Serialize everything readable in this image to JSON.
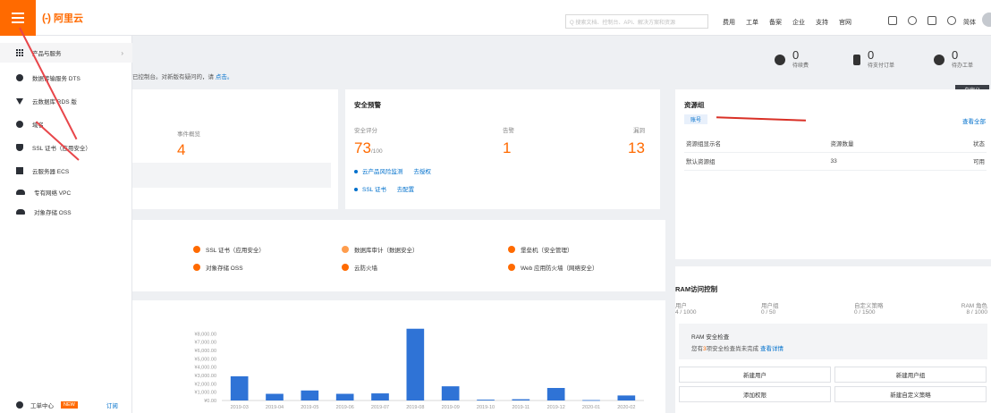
{
  "header": {
    "logo_mark": "(-)",
    "logo_text": "阿里云",
    "search_placeholder": "Q 搜索文档、控制台、API、解决方案和资源",
    "nav": [
      "费用",
      "工单",
      "备案",
      "企业",
      "支持",
      "官网"
    ],
    "lang": "简体"
  },
  "sidebar": {
    "items": [
      {
        "label": "产品与服务",
        "icon": "grid-icon"
      },
      {
        "label": "数据传输服务 DTS",
        "icon": "dts-icon"
      },
      {
        "label": "云数据库 RDS 版",
        "icon": "rds-icon"
      },
      {
        "label": "域名",
        "icon": "globe-icon"
      },
      {
        "label": "SSL 证书（应用安全）",
        "icon": "shield-icon"
      },
      {
        "label": "云服务器 ECS",
        "icon": "server-icon"
      },
      {
        "label": "专有网络 VPC",
        "icon": "cloud-icon"
      },
      {
        "label": "对象存储 OSS",
        "icon": "storage-icon"
      }
    ],
    "bottom": {
      "label": "工单中心",
      "badge": "NEW",
      "link": "订阅"
    }
  },
  "notice": {
    "text": "已控制台。对新版有疑问的，请 ",
    "link": "点击。"
  },
  "counters": [
    {
      "value": "0",
      "label": "待续费"
    },
    {
      "value": "0",
      "label": "待支付订单"
    },
    {
      "value": "0",
      "label": "待办工单"
    }
  ],
  "customize_label": "自定义",
  "overview": {
    "label": "事件概览",
    "value": "4"
  },
  "security": {
    "title": "安全预警",
    "score_label": "安全评分",
    "score": "73",
    "score_total": "/100",
    "alert_label": "告警",
    "alert": "1",
    "vuln_label": "漏洞",
    "vuln": "13",
    "links": [
      {
        "label": "云产品风险监测",
        "action": "去授权"
      },
      {
        "label": "SSL 证书",
        "action": "去配置"
      }
    ]
  },
  "services": [
    {
      "label": "SSL 证书（应用安全）",
      "color": "#ff6a00"
    },
    {
      "label": "数据库审计（数据安全）",
      "color": "#ff9d4d"
    },
    {
      "label": "堡垒机（安全管理）",
      "color": "#ff6a00"
    },
    {
      "label": "对象存储 OSS",
      "color": "#ff6a00"
    },
    {
      "label": "云防火墙",
      "color": "#ff6a00"
    },
    {
      "label": "Web 应用防火墙（网络安全）",
      "color": "#ff6a00"
    }
  ],
  "resource_group": {
    "title": "资源组",
    "view_all": "查看全部",
    "account_tab": "账号",
    "headers": [
      "资源组显示名",
      "资源数量",
      "状态"
    ],
    "rows": [
      [
        "默认资源组",
        "33",
        "可用"
      ]
    ]
  },
  "ram": {
    "title": "RAM访问控制",
    "stats": [
      {
        "label": "用户",
        "value": "4 / 1000"
      },
      {
        "label": "用户组",
        "value": "0 / 50"
      },
      {
        "label": "自定义策略",
        "value": "0 / 1500"
      },
      {
        "label": "RAM 角色",
        "value": "8 / 1000"
      }
    ],
    "check_title": "RAM 安全检查",
    "check_text_pre": "您有",
    "check_count": "3",
    "check_text_post": "项安全检查尚未完成",
    "check_link": "查看详情",
    "buttons": [
      "新建用户",
      "新建用户组",
      "添加权限",
      "新建自定义策略"
    ]
  },
  "chart_data": {
    "type": "bar",
    "categories": [
      "2019-03",
      "2019-04",
      "2019-05",
      "2019-06",
      "2019-07",
      "2019-08",
      "2019-09",
      "2019-10",
      "2019-11",
      "2019-12",
      "2020-01",
      "2020-02"
    ],
    "values": [
      2900,
      800,
      1200,
      800,
      850,
      8600,
      1700,
      100,
      150,
      1500,
      50,
      600
    ],
    "ytick_labels": [
      "¥8,000.00",
      "¥7,000.00",
      "¥6,000.00",
      "¥5,000.00",
      "¥4,000.00",
      "¥3,000.00",
      "¥2,000.00",
      "¥1,000.00",
      "¥0.00"
    ],
    "ylim": [
      0,
      9000
    ],
    "color": "#2f73d6"
  }
}
